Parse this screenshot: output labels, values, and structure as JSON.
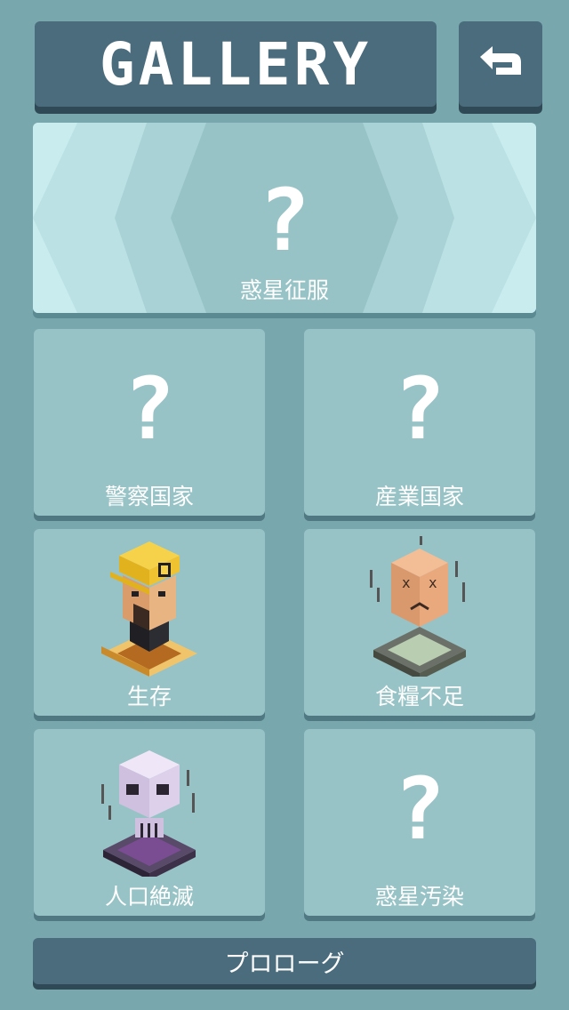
{
  "header": {
    "title": "GALLERY"
  },
  "featured": {
    "question": "?",
    "label": "惑星征服"
  },
  "cards": [
    {
      "question": "?",
      "label": "警察国家"
    },
    {
      "question": "?",
      "label": "産業国家"
    },
    {
      "label": "生存",
      "icon": "miner-icon"
    },
    {
      "label": "食糧不足",
      "icon": "starving-head-icon"
    },
    {
      "label": "人口絶滅",
      "icon": "skull-icon"
    },
    {
      "question": "?",
      "label": "惑星汚染"
    }
  ],
  "footer": {
    "prologue_label": "プロローグ"
  },
  "icons": {
    "back": "back-arrow-icon"
  }
}
